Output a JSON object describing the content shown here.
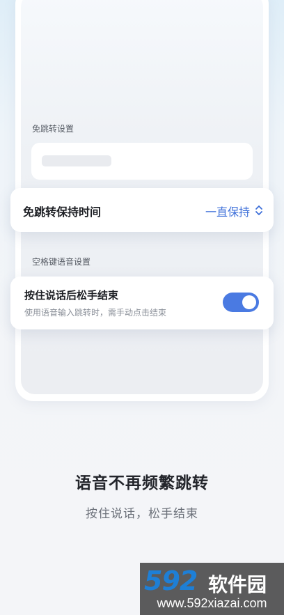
{
  "settings": {
    "no_jump_section_label": "免跳转设置",
    "keep_time": {
      "label": "免跳转保持时间",
      "value": "一直保持",
      "icon": "chevron-up-down-icon"
    },
    "space_voice_section_label": "空格键语音设置",
    "hold_to_talk": {
      "label": "按住说话后松手结束",
      "description": "使用语音输入跳转时，需手动点击结束",
      "enabled": true
    }
  },
  "promo": {
    "headline": "语音不再频繁跳转",
    "subline": "按住说话，松手结束"
  },
  "watermark": {
    "logo_number": "592",
    "logo_name": "软件园",
    "url": "www.592xiazai.com"
  },
  "colors": {
    "accent": "#4a7ae2",
    "value_text": "#3d6fd9",
    "watermark_logo": "#1e7fd6"
  }
}
